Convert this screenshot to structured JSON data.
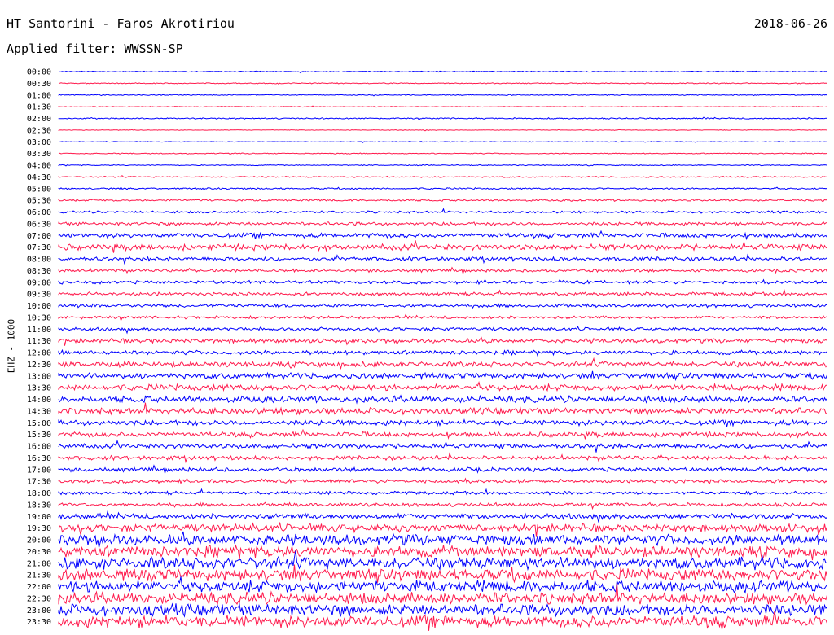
{
  "header": {
    "station": "HT Santorini - Faros Akrotiriou",
    "date": "2018-06-26",
    "filter": "Applied filter: WWSSN-SP"
  },
  "chart_data": {
    "type": "line",
    "title": "HT Santorini - Faros Akrotiriou",
    "ylabel": "EHZ - 1000",
    "colors": [
      "#0000ff",
      "#ff1a4d"
    ],
    "rows": [
      {
        "label": "00:00",
        "noise": 0.15
      },
      {
        "label": "00:30",
        "noise": 0.15
      },
      {
        "label": "01:00",
        "noise": 0.15
      },
      {
        "label": "01:30",
        "noise": 0.12
      },
      {
        "label": "02:00",
        "noise": 0.2
      },
      {
        "label": "02:30",
        "noise": 0.1
      },
      {
        "label": "03:00",
        "noise": 0.1
      },
      {
        "label": "03:30",
        "noise": 0.15
      },
      {
        "label": "04:00",
        "noise": 0.15
      },
      {
        "label": "04:30",
        "noise": 0.2
      },
      {
        "label": "05:00",
        "noise": 0.25
      },
      {
        "label": "05:30",
        "noise": 0.3
      },
      {
        "label": "06:00",
        "noise": 0.35
      },
      {
        "label": "06:30",
        "noise": 0.5
      },
      {
        "label": "07:00",
        "noise": 0.7
      },
      {
        "label": "07:30",
        "noise": 0.9
      },
      {
        "label": "08:00",
        "noise": 0.6
      },
      {
        "label": "08:30",
        "noise": 0.45
      },
      {
        "label": "09:00",
        "noise": 0.5
      },
      {
        "label": "09:30",
        "noise": 0.5
      },
      {
        "label": "10:00",
        "noise": 0.5
      },
      {
        "label": "10:30",
        "noise": 0.45
      },
      {
        "label": "11:00",
        "noise": 0.5
      },
      {
        "label": "11:30",
        "noise": 0.65
      },
      {
        "label": "12:00",
        "noise": 0.65
      },
      {
        "label": "12:30",
        "noise": 0.8
      },
      {
        "label": "13:00",
        "noise": 0.85
      },
      {
        "label": "13:30",
        "noise": 0.95
      },
      {
        "label": "14:00",
        "noise": 1.0
      },
      {
        "label": "14:30",
        "noise": 0.95
      },
      {
        "label": "15:00",
        "noise": 0.8
      },
      {
        "label": "15:30",
        "noise": 0.75
      },
      {
        "label": "16:00",
        "noise": 0.7
      },
      {
        "label": "16:30",
        "noise": 0.65
      },
      {
        "label": "17:00",
        "noise": 0.6
      },
      {
        "label": "17:30",
        "noise": 0.55
      },
      {
        "label": "18:00",
        "noise": 0.5
      },
      {
        "label": "18:30",
        "noise": 0.55
      },
      {
        "label": "19:00",
        "noise": 0.8
      },
      {
        "label": "19:30",
        "noise": 1.2
      },
      {
        "label": "20:00",
        "noise": 1.6
      },
      {
        "label": "20:30",
        "noise": 1.7
      },
      {
        "label": "21:00",
        "noise": 1.8
      },
      {
        "label": "21:30",
        "noise": 1.8
      },
      {
        "label": "22:00",
        "noise": 1.8
      },
      {
        "label": "22:30",
        "noise": 1.8
      },
      {
        "label": "23:00",
        "noise": 1.8
      },
      {
        "label": "23:30",
        "noise": 1.8
      }
    ]
  }
}
